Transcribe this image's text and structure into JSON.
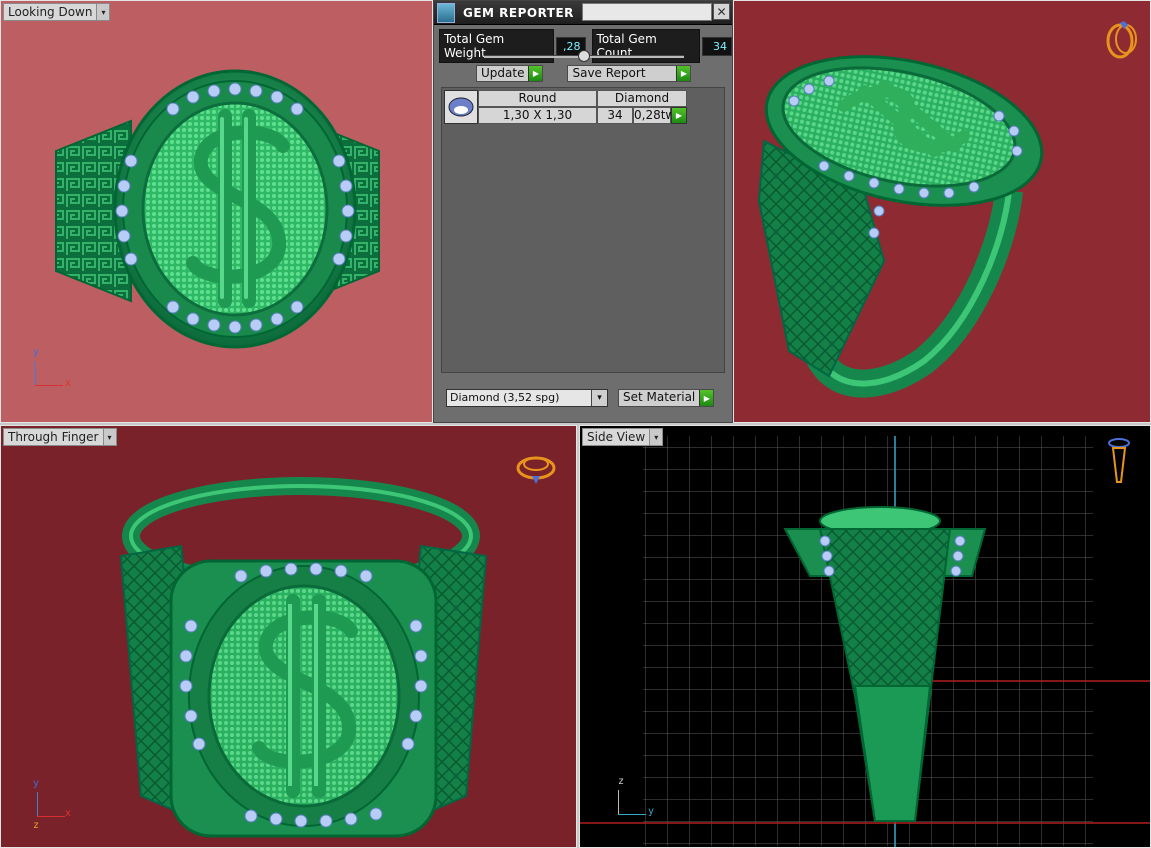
{
  "viewports": {
    "top_left": {
      "label": "Looking Down"
    },
    "top_right": {
      "label": ""
    },
    "bottom_left": {
      "label": "Through Finger"
    },
    "bottom_right": {
      "label": "Side View"
    }
  },
  "gem_reporter": {
    "title": "GEM REPORTER",
    "close_glyph": "✕",
    "total_weight_label": "Total Gem Weight",
    "total_weight_value": ",28",
    "total_count_label": "Total Gem Count",
    "total_count_value": "34",
    "update_label": "Update",
    "save_report_label": "Save Report",
    "table": {
      "header_shape": "Round",
      "header_material": "Diamond",
      "size": "1,30 X 1,30",
      "count": "34",
      "weight": "0,28tw"
    },
    "material_select": "Diamond     (3,52 spg)",
    "set_material_label": "Set Material"
  },
  "axes": {
    "top_left": {
      "v": "y",
      "h": "x"
    },
    "bottom_left": {
      "v": "y",
      "h": "x",
      "depth": "z"
    },
    "bottom_right": {
      "v": "z",
      "h": "y"
    }
  },
  "colors": {
    "ring_green": "#1f8f55",
    "ring_dark": "#0b5a33",
    "gem_blue": "#a8c4f0",
    "dollar_green": "#2fae5c"
  },
  "icons": {
    "viewport_dropdown": "▾",
    "go_arrow": "▶",
    "select_arrow": "▾"
  }
}
